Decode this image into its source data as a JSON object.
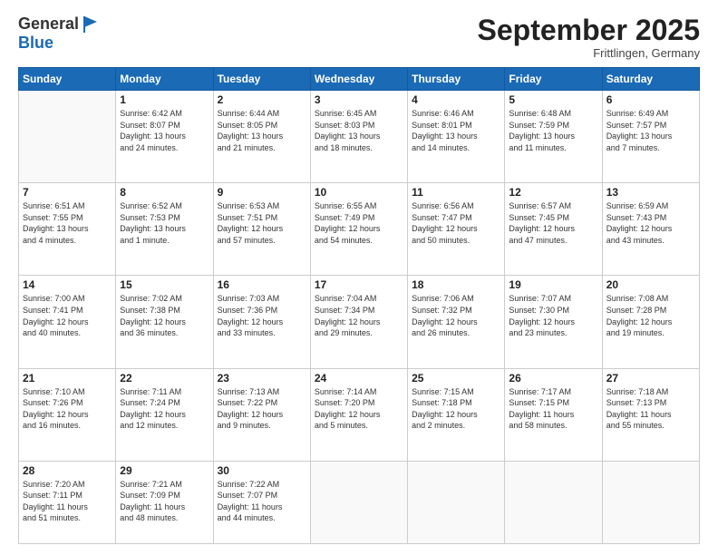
{
  "logo": {
    "general": "General",
    "blue": "Blue"
  },
  "title": "September 2025",
  "subtitle": "Frittlingen, Germany",
  "days_header": [
    "Sunday",
    "Monday",
    "Tuesday",
    "Wednesday",
    "Thursday",
    "Friday",
    "Saturday"
  ],
  "weeks": [
    [
      {
        "day": "",
        "info": ""
      },
      {
        "day": "1",
        "info": "Sunrise: 6:42 AM\nSunset: 8:07 PM\nDaylight: 13 hours\nand 24 minutes."
      },
      {
        "day": "2",
        "info": "Sunrise: 6:44 AM\nSunset: 8:05 PM\nDaylight: 13 hours\nand 21 minutes."
      },
      {
        "day": "3",
        "info": "Sunrise: 6:45 AM\nSunset: 8:03 PM\nDaylight: 13 hours\nand 18 minutes."
      },
      {
        "day": "4",
        "info": "Sunrise: 6:46 AM\nSunset: 8:01 PM\nDaylight: 13 hours\nand 14 minutes."
      },
      {
        "day": "5",
        "info": "Sunrise: 6:48 AM\nSunset: 7:59 PM\nDaylight: 13 hours\nand 11 minutes."
      },
      {
        "day": "6",
        "info": "Sunrise: 6:49 AM\nSunset: 7:57 PM\nDaylight: 13 hours\nand 7 minutes."
      }
    ],
    [
      {
        "day": "7",
        "info": "Sunrise: 6:51 AM\nSunset: 7:55 PM\nDaylight: 13 hours\nand 4 minutes."
      },
      {
        "day": "8",
        "info": "Sunrise: 6:52 AM\nSunset: 7:53 PM\nDaylight: 13 hours\nand 1 minute."
      },
      {
        "day": "9",
        "info": "Sunrise: 6:53 AM\nSunset: 7:51 PM\nDaylight: 12 hours\nand 57 minutes."
      },
      {
        "day": "10",
        "info": "Sunrise: 6:55 AM\nSunset: 7:49 PM\nDaylight: 12 hours\nand 54 minutes."
      },
      {
        "day": "11",
        "info": "Sunrise: 6:56 AM\nSunset: 7:47 PM\nDaylight: 12 hours\nand 50 minutes."
      },
      {
        "day": "12",
        "info": "Sunrise: 6:57 AM\nSunset: 7:45 PM\nDaylight: 12 hours\nand 47 minutes."
      },
      {
        "day": "13",
        "info": "Sunrise: 6:59 AM\nSunset: 7:43 PM\nDaylight: 12 hours\nand 43 minutes."
      }
    ],
    [
      {
        "day": "14",
        "info": "Sunrise: 7:00 AM\nSunset: 7:41 PM\nDaylight: 12 hours\nand 40 minutes."
      },
      {
        "day": "15",
        "info": "Sunrise: 7:02 AM\nSunset: 7:38 PM\nDaylight: 12 hours\nand 36 minutes."
      },
      {
        "day": "16",
        "info": "Sunrise: 7:03 AM\nSunset: 7:36 PM\nDaylight: 12 hours\nand 33 minutes."
      },
      {
        "day": "17",
        "info": "Sunrise: 7:04 AM\nSunset: 7:34 PM\nDaylight: 12 hours\nand 29 minutes."
      },
      {
        "day": "18",
        "info": "Sunrise: 7:06 AM\nSunset: 7:32 PM\nDaylight: 12 hours\nand 26 minutes."
      },
      {
        "day": "19",
        "info": "Sunrise: 7:07 AM\nSunset: 7:30 PM\nDaylight: 12 hours\nand 23 minutes."
      },
      {
        "day": "20",
        "info": "Sunrise: 7:08 AM\nSunset: 7:28 PM\nDaylight: 12 hours\nand 19 minutes."
      }
    ],
    [
      {
        "day": "21",
        "info": "Sunrise: 7:10 AM\nSunset: 7:26 PM\nDaylight: 12 hours\nand 16 minutes."
      },
      {
        "day": "22",
        "info": "Sunrise: 7:11 AM\nSunset: 7:24 PM\nDaylight: 12 hours\nand 12 minutes."
      },
      {
        "day": "23",
        "info": "Sunrise: 7:13 AM\nSunset: 7:22 PM\nDaylight: 12 hours\nand 9 minutes."
      },
      {
        "day": "24",
        "info": "Sunrise: 7:14 AM\nSunset: 7:20 PM\nDaylight: 12 hours\nand 5 minutes."
      },
      {
        "day": "25",
        "info": "Sunrise: 7:15 AM\nSunset: 7:18 PM\nDaylight: 12 hours\nand 2 minutes."
      },
      {
        "day": "26",
        "info": "Sunrise: 7:17 AM\nSunset: 7:15 PM\nDaylight: 11 hours\nand 58 minutes."
      },
      {
        "day": "27",
        "info": "Sunrise: 7:18 AM\nSunset: 7:13 PM\nDaylight: 11 hours\nand 55 minutes."
      }
    ],
    [
      {
        "day": "28",
        "info": "Sunrise: 7:20 AM\nSunset: 7:11 PM\nDaylight: 11 hours\nand 51 minutes."
      },
      {
        "day": "29",
        "info": "Sunrise: 7:21 AM\nSunset: 7:09 PM\nDaylight: 11 hours\nand 48 minutes."
      },
      {
        "day": "30",
        "info": "Sunrise: 7:22 AM\nSunset: 7:07 PM\nDaylight: 11 hours\nand 44 minutes."
      },
      {
        "day": "",
        "info": ""
      },
      {
        "day": "",
        "info": ""
      },
      {
        "day": "",
        "info": ""
      },
      {
        "day": "",
        "info": ""
      }
    ]
  ]
}
